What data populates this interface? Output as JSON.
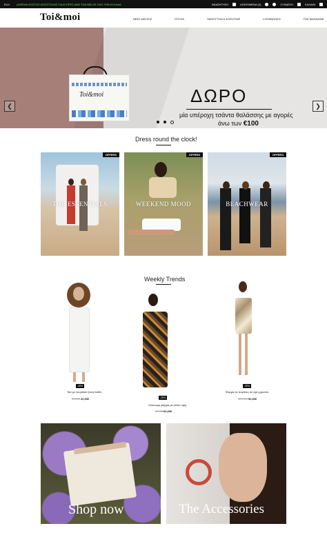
{
  "topbar": {
    "lang": "ΕΛΛ",
    "promo": "ΔΩΡΕΑΝ ΚΟΣΤΟΣ ΑΠΟΣΤΟΛΗΣ ΓΙΑ ΑΓΟΡΕΣ ΑΝΩ ΤΩΝ €50 ΣΕ ΟΛΗ ΤΗΝ ΕΛΛΑΔΑ",
    "search": "ΑΝΑΖΗΤΗΣΗ",
    "wishlist": "ΑΓΑΠΗΜΕΝΑ (0)",
    "login": "ΣΥΝΔΕΣΗ",
    "cart": "ΚΑΛΑΘΙ"
  },
  "header": {
    "logo": "Toi&moi",
    "nav": [
      "ΝΕΕΣ ΑΦΙΞΕΙΣ",
      "ΡΟΥΧΑ",
      "ΠΑΠΟΥΤΣΙΑ & ΑΞΕΣΟΥΑΡ",
      "LOOKBOOKS",
      "THE MAGAZINE"
    ]
  },
  "hero": {
    "title": "ΔΩΡΟ",
    "subtitle1": "μία υπέροχη τσάντα θαλάσσης με αγορές",
    "subtitle2_prefix": "άνω των",
    "subtitle2_value": "€100",
    "bag_text": "Toi&moi",
    "colors": {
      "wall": "#a57f78",
      "background": "#e7e5e3"
    }
  },
  "dress_section": {
    "title": "Dress round the clock!",
    "cards": [
      {
        "label": "THE ESSENTIALS",
        "badge": "OFFERS"
      },
      {
        "label": "WEEKEND MOOD",
        "badge": "OFFERS"
      },
      {
        "label": "BEACHWEAR",
        "badge": "OFFERS"
      }
    ]
  },
  "weekly": {
    "title": "Weekly Trends",
    "products": [
      {
        "badge": "-30%",
        "name": "Τοπ με λουρίκια/ ζώνη halter",
        "old": "29,90€",
        "new": "20,93€"
      },
      {
        "badge": "-30%",
        "name": "Ολόσωμη φόρμα με σατέν υφή",
        "old": "49,90€",
        "new": "34,93€"
      },
      {
        "badge": "-30%",
        "name": "Φόρμα σε παγιέτες σε όψη χρυσού",
        "old": "129,90€",
        "new": "90,93€"
      }
    ]
  },
  "bottom": {
    "left": "Shop now",
    "right": "The Accessories"
  },
  "colors": {
    "accent": "#111111",
    "promo": "#6ee07a"
  }
}
